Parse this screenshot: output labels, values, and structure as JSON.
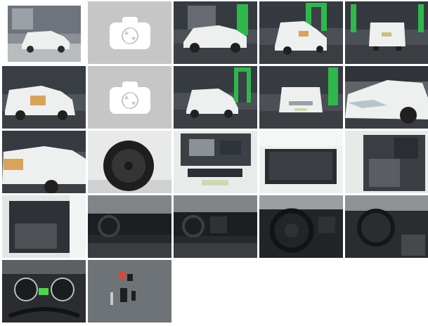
{
  "gallery": {
    "photos": [
      {
        "kind": "photo",
        "subject": "car-front-three-quarter-outdoor"
      },
      {
        "kind": "placeholder",
        "icon": "camera-refresh-icon"
      },
      {
        "kind": "photo",
        "subject": "car-side-left"
      },
      {
        "kind": "photo",
        "subject": "car-rear-left-three-quarter"
      },
      {
        "kind": "photo",
        "subject": "car-rear"
      },
      {
        "kind": "photo",
        "subject": "car-rear-left-damage"
      },
      {
        "kind": "placeholder",
        "icon": "camera-refresh-icon"
      },
      {
        "kind": "photo",
        "subject": "car-front-three-quarter"
      },
      {
        "kind": "photo",
        "subject": "car-front"
      },
      {
        "kind": "photo",
        "subject": "car-front-closeup"
      },
      {
        "kind": "photo",
        "subject": "car-left-side-damage"
      },
      {
        "kind": "photo",
        "subject": "wheel-closeup"
      },
      {
        "kind": "photo",
        "subject": "engine-bay"
      },
      {
        "kind": "photo",
        "subject": "trunk-open"
      },
      {
        "kind": "photo",
        "subject": "front-seat"
      },
      {
        "kind": "photo",
        "subject": "rear-seat"
      },
      {
        "kind": "photo",
        "subject": "dashboard"
      },
      {
        "kind": "photo",
        "subject": "dashboard-center"
      },
      {
        "kind": "photo",
        "subject": "steering-wheel"
      },
      {
        "kind": "photo",
        "subject": "steering-wheel-side"
      },
      {
        "kind": "photo",
        "subject": "instrument-cluster"
      },
      {
        "kind": "photo",
        "subject": "car-keys"
      }
    ],
    "colors": {
      "placeholder_bg": "#c6c6c6",
      "placeholder_icon": "#ffffff",
      "accent_green": "#2fb84a",
      "car_white": "#eef0f0"
    }
  }
}
